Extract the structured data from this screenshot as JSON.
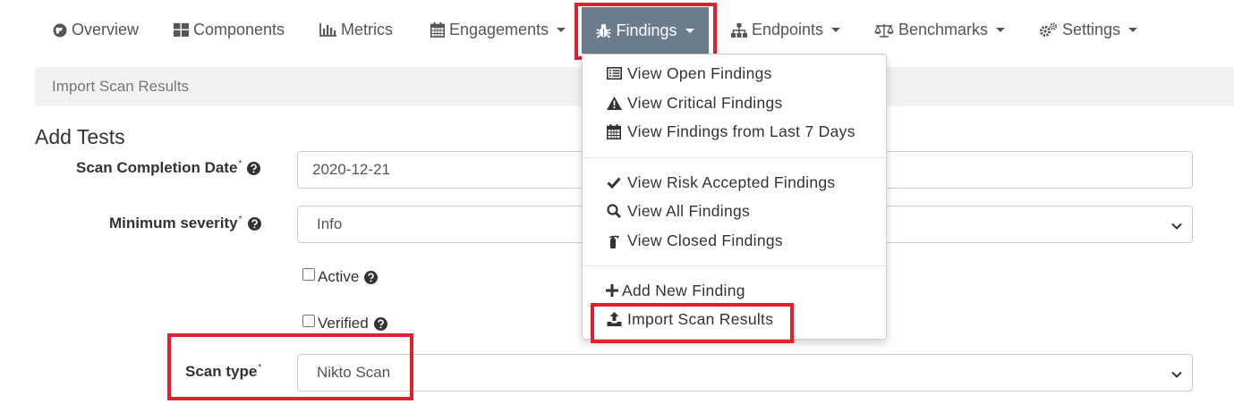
{
  "nav": {
    "items": [
      {
        "label": "Overview",
        "icon": "globe-icon"
      },
      {
        "label": "Components",
        "icon": "grid-icon"
      },
      {
        "label": "Metrics",
        "icon": "bar-chart-icon"
      },
      {
        "label": "Engagements",
        "icon": "calendar-icon",
        "caret": true
      },
      {
        "label": "Findings",
        "icon": "bug-icon",
        "caret": true,
        "active": true
      },
      {
        "label": "Endpoints",
        "icon": "sitemap-icon",
        "caret": true
      },
      {
        "label": "Benchmarks",
        "icon": "balance-scale-icon",
        "caret": true
      },
      {
        "label": "Settings",
        "icon": "gears-icon",
        "caret": true
      }
    ]
  },
  "breadcrumb": {
    "current": "Import Scan Results"
  },
  "page_title": "Add Tests",
  "form": {
    "scan_completion_date": {
      "label": "Scan Completion Date",
      "required": "*",
      "value": "2020-12-21"
    },
    "minimum_severity": {
      "label": "Minimum severity",
      "required": "*",
      "value": "Info"
    },
    "active": {
      "label": "Active",
      "checked": false
    },
    "verified": {
      "label": "Verified",
      "checked": false
    },
    "scan_type": {
      "label": "Scan type",
      "required": "*",
      "value": "Nikto Scan"
    }
  },
  "findings_menu": {
    "items": [
      {
        "label": "View Open Findings",
        "icon": "list-icon"
      },
      {
        "label": "View Critical Findings",
        "icon": "warning-icon"
      },
      {
        "label": "View Findings from Last 7 Days",
        "icon": "calendar-icon"
      },
      {
        "label": "View Risk Accepted Findings",
        "icon": "check-icon"
      },
      {
        "label": "View All Findings",
        "icon": "search-icon"
      },
      {
        "label": "View Closed Findings",
        "icon": "fire-extinguisher-icon"
      },
      {
        "label": "Add New Finding",
        "icon": "plus-icon"
      },
      {
        "label": "Import Scan Results",
        "icon": "upload-icon"
      }
    ]
  },
  "colors": {
    "active_nav_bg": "#6b7c8d",
    "highlight": "#e0202c",
    "breadcrumb_bg": "#f2f2f2"
  }
}
